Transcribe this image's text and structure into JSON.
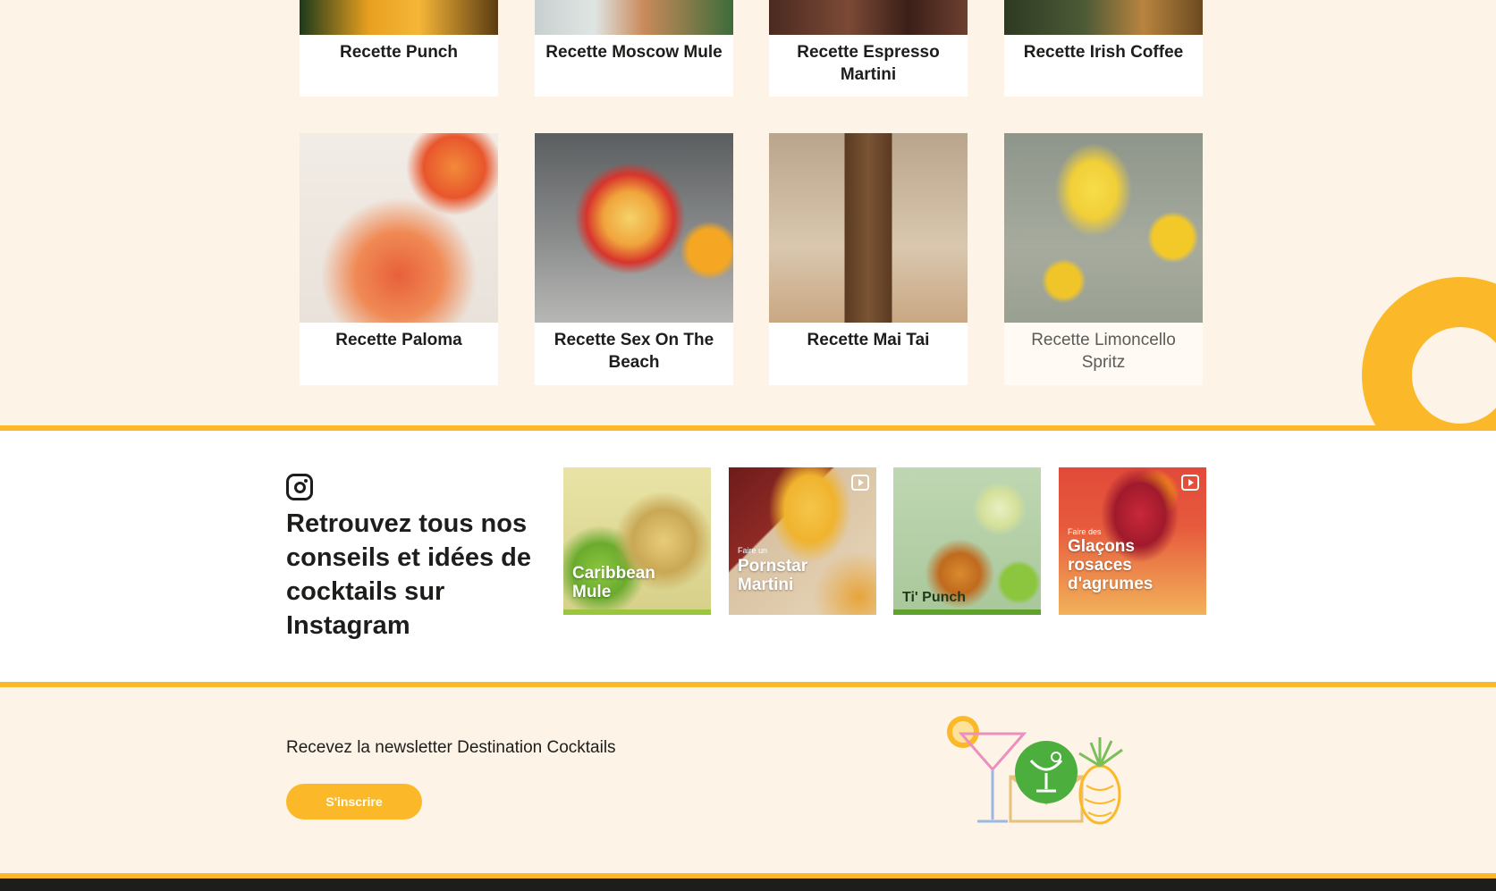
{
  "recipes": {
    "row1": [
      {
        "title": "Recette Punch"
      },
      {
        "title": "Recette Moscow Mule"
      },
      {
        "title": "Recette Espresso Martini"
      },
      {
        "title": "Recette Irish Coffee"
      }
    ],
    "row2": [
      {
        "title": "Recette Paloma"
      },
      {
        "title": "Recette Sex On The Beach"
      },
      {
        "title": "Recette Mai Tai"
      },
      {
        "title": "Recette Limoncello Spritz"
      }
    ]
  },
  "instagram": {
    "icon": "instagram-icon",
    "heading": "Retrouvez tous nos conseils et idées de cocktails sur Instagram",
    "posts": [
      {
        "title": "Caribbean Mule",
        "kicker": ""
      },
      {
        "title": "Pornstar Martini",
        "kicker": "Faire un"
      },
      {
        "title": "Ti' Punch",
        "kicker": ""
      },
      {
        "title": "Glaçons rosaces d'agrumes",
        "kicker": "Faire des"
      }
    ]
  },
  "newsletter": {
    "text": "Recevez la newsletter Destination Cocktails",
    "button": "S'inscrire"
  },
  "colors": {
    "accent": "#fbb829",
    "background": "#fdf3e6",
    "text": "#1d1d1b",
    "green": "#4caf3d"
  }
}
